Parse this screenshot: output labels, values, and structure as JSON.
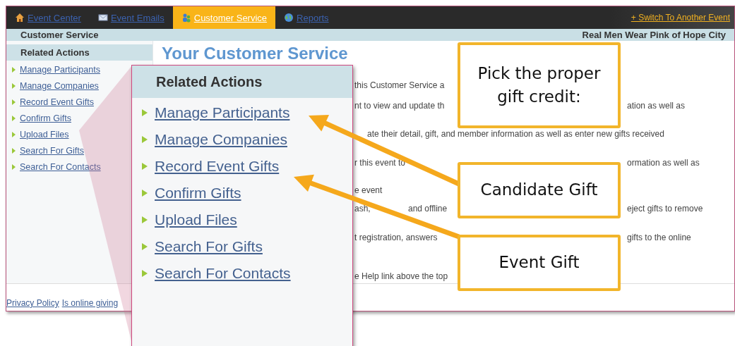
{
  "nav": {
    "tabs": [
      {
        "label": "Event Center",
        "kind": "home",
        "selected": false
      },
      {
        "label": "Event Emails",
        "kind": "mail",
        "selected": false
      },
      {
        "label": "Customer Service",
        "kind": "people",
        "selected": true
      },
      {
        "label": "Reports",
        "kind": "globe",
        "selected": false
      }
    ],
    "switch_link": "+ Switch To Another Event"
  },
  "header": {
    "section": "Customer Service",
    "event": "Real Men Wear Pink of Hope City"
  },
  "sidebar": {
    "title": "Related Actions",
    "items": [
      "Manage Participants",
      "Manage Companies",
      "Record Event Gifts",
      "Confirm Gifts",
      "Upload Files",
      "Search For Gifts",
      "Search For Contacts"
    ]
  },
  "content": {
    "title": "Your Customer Service",
    "lines": [
      {
        "parts": [
          "this Customer Service a"
        ]
      },
      {
        "parts": [
          "nt to view and update th",
          "ation as well as"
        ]
      },
      {
        "parts": [
          "ate their detail, gift, and member information as well as enter new gifts received"
        ]
      },
      {
        "parts": [
          "r this event to",
          "ormation as well as"
        ]
      },
      {
        "parts": [
          "e event"
        ]
      },
      {
        "parts": [
          "ash,",
          "and offline",
          "eject gifts to remove"
        ]
      },
      {
        "parts": [
          "t registration, answers",
          "gifts to the online"
        ]
      },
      {
        "parts": [
          "e Help link above the top"
        ]
      }
    ]
  },
  "footer": {
    "links": [
      "Privacy Policy",
      "Is online giving"
    ]
  },
  "zoom_panel": {
    "title": "Related Actions",
    "items": [
      "Manage Participants",
      "Manage Companies",
      "Record Event Gifts",
      "Confirm Gifts",
      "Upload Files",
      "Search For Gifts",
      "Search For Contacts"
    ]
  },
  "callouts": [
    {
      "text": "Pick the proper gift credit:"
    },
    {
      "text": "Candidate Gift"
    },
    {
      "text": "Event Gift"
    }
  ]
}
